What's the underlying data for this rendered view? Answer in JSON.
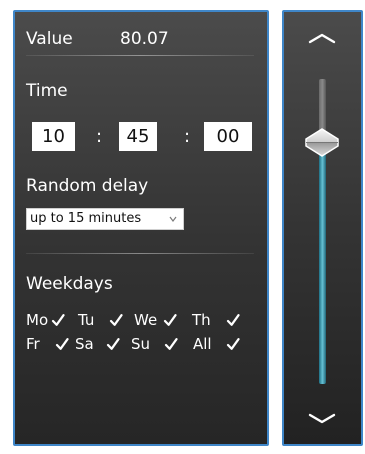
{
  "panel": {
    "value_label": "Value",
    "value_number": "80.07",
    "time_heading": "Time",
    "time": {
      "hours": "10",
      "separator1": ":",
      "minutes": "45",
      "separator2": ":",
      "seconds": "00"
    },
    "random_delay_heading": "Random delay",
    "random_delay_selected": "up to 15 minutes",
    "weekdays_heading": "Weekdays",
    "weekdays": [
      {
        "label": "Mo",
        "checked": true
      },
      {
        "label": "Tu",
        "checked": true
      },
      {
        "label": "We",
        "checked": true
      },
      {
        "label": "Th",
        "checked": true
      },
      {
        "label": "Fr",
        "checked": true
      },
      {
        "label": "Sa",
        "checked": true
      },
      {
        "label": "Su",
        "checked": true
      },
      {
        "label": "All",
        "checked": true
      }
    ]
  },
  "slider": {
    "level_fraction": 0.75
  },
  "colors": {
    "accent_border": "#3f86c8",
    "slider_fill": "#3ea6be",
    "panel_bg": "#3a3a3a"
  },
  "icons": {
    "slider_up": "chevron-up-icon",
    "slider_down": "chevron-down-icon",
    "select_arrow": "chevron-down-icon",
    "weekday_check": "check-icon"
  }
}
